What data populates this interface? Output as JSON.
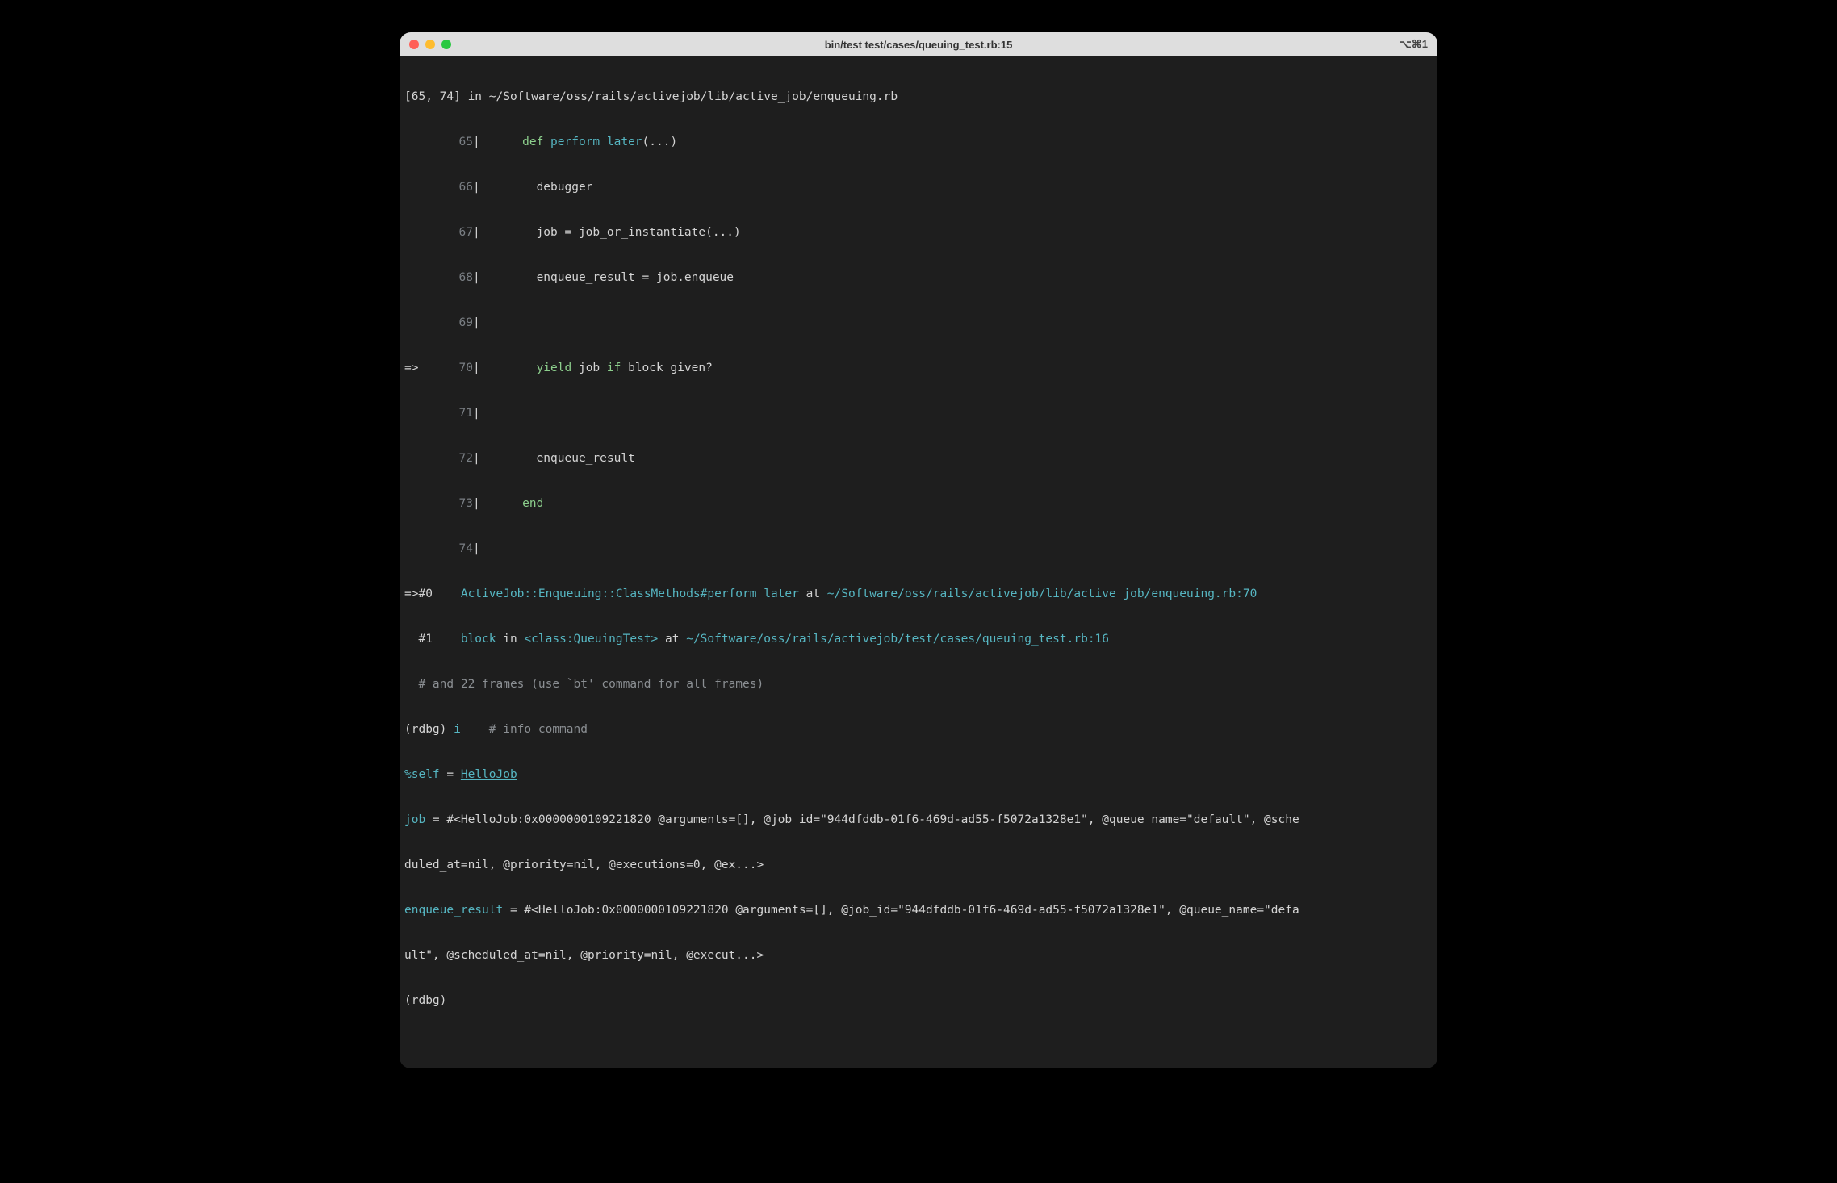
{
  "titlebar": {
    "title": "bin/test test/cases/queuing_test.rb:15",
    "shortcut": "⌥⌘1"
  },
  "source": {
    "header": "[65, 74] in ~/Software/oss/rails/activejob/lib/active_job/enqueuing.rb",
    "current_line": 70,
    "lines": [
      {
        "n": 65,
        "kw": "def ",
        "mname": "perform_later",
        "rest": "(...)"
      },
      {
        "n": 66,
        "indent": "        ",
        "code": "debugger"
      },
      {
        "n": 67,
        "indent": "        ",
        "code": "job = job_or_instantiate(...)"
      },
      {
        "n": 68,
        "indent": "        ",
        "code": "enqueue_result = job.enqueue"
      },
      {
        "n": 69,
        "indent": "",
        "code": ""
      },
      {
        "n": 70,
        "indent": "        ",
        "kw": "yield",
        "mid": " job ",
        "kw2": "if",
        "rest": " block_given?"
      },
      {
        "n": 71,
        "indent": "",
        "code": ""
      },
      {
        "n": 72,
        "indent": "        ",
        "code": "enqueue_result"
      },
      {
        "n": 73,
        "indent": "      ",
        "kw": "end"
      },
      {
        "n": 74,
        "indent": "",
        "code": ""
      }
    ]
  },
  "frames": {
    "f0_ptr": "=>#0",
    "f0_loc": "ActiveJob::Enqueuing::ClassMethods#perform_later",
    "f0_at": " at ",
    "f0_path": "~/Software/oss/rails/activejob/lib/active_job/enqueuing.rb:70",
    "f1_ptr": "  #1",
    "f1_block": "block",
    "f1_in": " in ",
    "f1_class": "<class:QueuingTest>",
    "f1_at": " at ",
    "f1_path": "~/Software/oss/rails/activejob/test/cases/queuing_test.rb:16",
    "more": "  # and 22 frames (use `bt' command for all frames)"
  },
  "repl": {
    "prompt1_prefix": "(rdbg) ",
    "prompt1_cmd": "i",
    "prompt1_comment": "    # info command",
    "self_label": "%self",
    "self_eq": " = ",
    "self_val": "HelloJob",
    "job_label": "job",
    "job_eq": " = ",
    "job_val": "#<HelloJob:0x0000000109221820 @arguments=[], @job_id=\"944dfddb-01f6-469d-ad55-f5072a1328e1\", @queue_name=\"default\", @sche",
    "job_val2": "duled_at=nil, @priority=nil, @executions=0, @ex...>",
    "enq_label": "enqueue_result",
    "enq_eq": " = ",
    "enq_val": "#<HelloJob:0x0000000109221820 @arguments=[], @job_id=\"944dfddb-01f6-469d-ad55-f5072a1328e1\", @queue_name=\"defa",
    "enq_val2": "ult\", @scheduled_at=nil, @priority=nil, @execut...>",
    "prompt2": "(rdbg) "
  }
}
